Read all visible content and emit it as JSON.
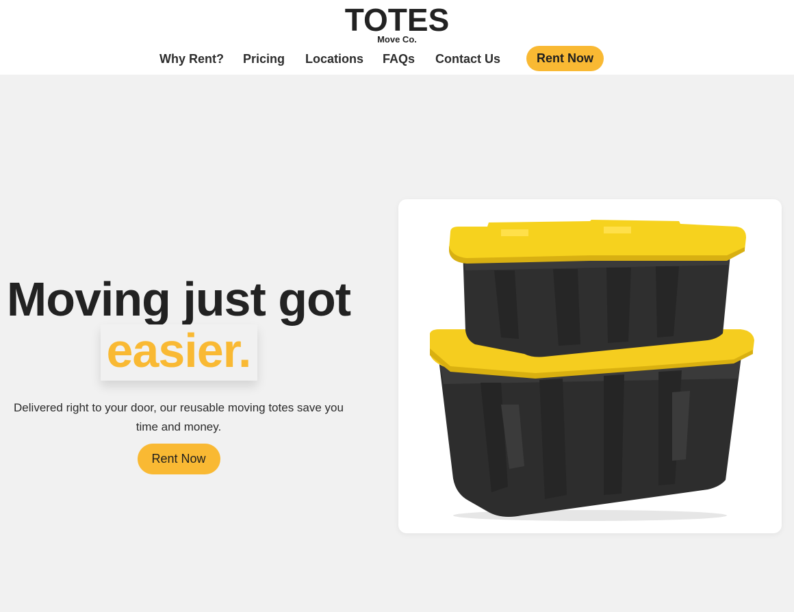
{
  "brand": {
    "title": "TOTES",
    "subtitle": "Move Co."
  },
  "nav": {
    "items": [
      {
        "label": "Why Rent?"
      },
      {
        "label": "Pricing"
      },
      {
        "label": "Locations"
      },
      {
        "label": "FAQs"
      },
      {
        "label": "Contact Us"
      }
    ],
    "cta_label": "Rent Now"
  },
  "hero": {
    "headline": "Moving just got",
    "headline_accent": "easier.",
    "subtext": "Delivered right to your door, our reusable moving totes save you time and money.",
    "cta_label": "Rent Now",
    "image_icon": "stacked-totes-image"
  },
  "colors": {
    "accent": "#f9b933",
    "background": "#f1f1f1",
    "header_bg": "#ffffff",
    "text": "#222222"
  }
}
